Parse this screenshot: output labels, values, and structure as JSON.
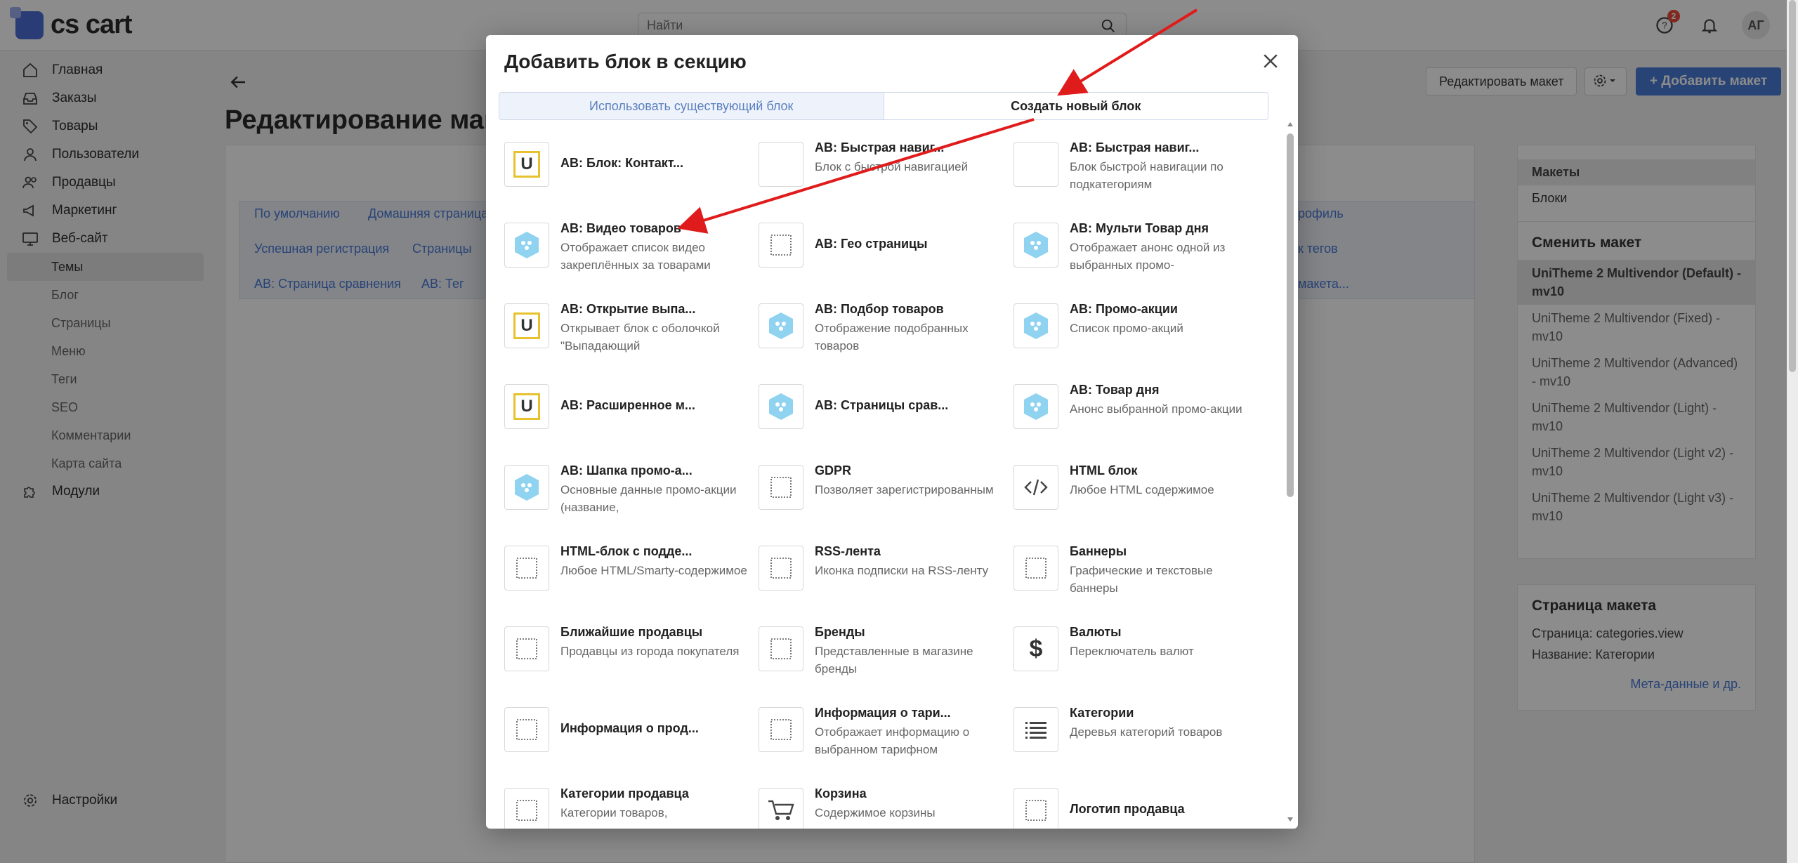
{
  "app": {
    "logo_text": "cs cart"
  },
  "search": {
    "placeholder": "Найти"
  },
  "header": {
    "notifications_count": "2",
    "avatar_initials": "АГ"
  },
  "sidebar": {
    "items": [
      {
        "label": "Главная",
        "icon": "home-icon"
      },
      {
        "label": "Заказы",
        "icon": "inbox-icon"
      },
      {
        "label": "Товары",
        "icon": "tag-icon"
      },
      {
        "label": "Пользователи",
        "icon": "user-icon"
      },
      {
        "label": "Продавцы",
        "icon": "users-icon"
      },
      {
        "label": "Маркетинг",
        "icon": "megaphone-icon"
      },
      {
        "label": "Веб-сайт",
        "icon": "monitor-icon"
      },
      {
        "label": "Модули",
        "icon": "puzzle-icon"
      },
      {
        "label": "Настройки",
        "icon": "gear-icon"
      }
    ],
    "subitems": [
      "Темы",
      "Блог",
      "Страницы",
      "Меню",
      "Теги",
      "SEO",
      "Комментарии",
      "Карта сайта"
    ]
  },
  "page": {
    "title": "Редактирование мак",
    "edit_layout_button": "Редактировать макет",
    "add_layout_button": "Добавить макет",
    "tabs": [
      "По умолчанию",
      "Домашняя страница",
      "Успешная регистрация",
      "Страницы",
      "AB: Страница сравнения",
      "AB: Тег"
    ],
    "tabs_right": [
      "рофиль",
      "к тегов",
      "макета..."
    ],
    "right_panel": {
      "layouts_label": "Макеты",
      "blocks_label": "Блоки",
      "change_layout_title": "Сменить макет",
      "layouts": [
        "UniTheme 2 Multivendor (Default) - mv10",
        "UniTheme 2 Multivendor (Fixed) - mv10",
        "UniTheme 2 Multivendor (Advanced) - mv10",
        "UniTheme 2 Multivendor (Light) - mv10",
        "UniTheme 2 Multivendor (Light v2) - mv10",
        "UniTheme 2 Multivendor (Light v3) - mv10"
      ],
      "layout_page_title": "Страница макета",
      "layout_page_info": "Страница: categories.view",
      "layout_name_info": "Название: Категории",
      "meta_link": "Мета-данные и др."
    }
  },
  "modal": {
    "title": "Добавить блок в секцию",
    "tab_existing": "Использовать существующий блок",
    "tab_new": "Создать новый блок",
    "blocks": [
      {
        "title": "AB: Блок: Контакт...",
        "desc": "",
        "icon": "u-icon"
      },
      {
        "title": "AB: Быстрая навиг...",
        "desc": "Блок с быстрой навигацией",
        "icon": "blank-icon"
      },
      {
        "title": "AB: Быстрая навиг...",
        "desc": "Блок быстрой навигации по подкатегориям",
        "icon": "blank-icon"
      },
      {
        "title": "AB: Видео товаров",
        "desc": "Отображает список видео закреплённых за товарами",
        "icon": "hex-icon"
      },
      {
        "title": "AB: Гео страницы",
        "desc": "",
        "icon": "dotted-square-icon"
      },
      {
        "title": "AB: Мульти Товар дня",
        "desc": "Отображает анонс одной из выбранных промо-",
        "icon": "hex-icon"
      },
      {
        "title": "AB: Открытие выпа...",
        "desc": "Открывает блок с оболочкой \"Выпадающий",
        "icon": "u-icon"
      },
      {
        "title": "AB: Подбор товаров",
        "desc": "Отображение подобранных товаров",
        "icon": "hex-icon"
      },
      {
        "title": "AB: Промо-акции",
        "desc": "Список промо-акций",
        "icon": "hex-icon"
      },
      {
        "title": "AB: Расширенное м...",
        "desc": "",
        "icon": "u-icon"
      },
      {
        "title": "AB: Страницы срав...",
        "desc": "",
        "icon": "hex-icon"
      },
      {
        "title": "AB: Товар дня",
        "desc": "Анонс выбранной промо-акции",
        "icon": "hex-icon"
      },
      {
        "title": "AB: Шапка промо-а...",
        "desc": "Основные данные промо-акции (название,",
        "icon": "hex-icon"
      },
      {
        "title": "GDPR",
        "desc": "Позволяет зарегистрированным",
        "icon": "dotted-square-icon"
      },
      {
        "title": "HTML блок",
        "desc": "Любое HTML содержимое",
        "icon": "code-icon"
      },
      {
        "title": "HTML-блок с подде...",
        "desc": "Любое HTML/Smarty-содержимое",
        "icon": "dotted-square-icon"
      },
      {
        "title": "RSS-лента",
        "desc": "Иконка подписки на RSS-ленту",
        "icon": "dotted-square-icon"
      },
      {
        "title": "Баннеры",
        "desc": "Графические и текстовые баннеры",
        "icon": "dotted-square-icon"
      },
      {
        "title": "Ближайшие продавцы",
        "desc": "Продавцы из города покупателя",
        "icon": "dotted-square-icon"
      },
      {
        "title": "Бренды",
        "desc": "Представленные в магазине бренды",
        "icon": "dotted-square-icon"
      },
      {
        "title": "Валюты",
        "desc": "Переключатель валют",
        "icon": "dollar-icon"
      },
      {
        "title": "Информация о прод...",
        "desc": "",
        "icon": "dotted-square-icon"
      },
      {
        "title": "Информация о тари...",
        "desc": "Отображает информацию о выбранном тарифном",
        "icon": "dotted-square-icon"
      },
      {
        "title": "Категории",
        "desc": "Деревья категорий товаров",
        "icon": "list-icon"
      },
      {
        "title": "Категории продавца",
        "desc": "Категории товаров,",
        "icon": "dotted-square-icon"
      },
      {
        "title": "Корзина",
        "desc": "Содержимое корзины",
        "icon": "cart-icon"
      },
      {
        "title": "Логотип продавца",
        "desc": "",
        "icon": "dotted-square-icon"
      }
    ]
  },
  "colors": {
    "accent": "#4a7bd8",
    "arrow": "#e01b1b",
    "hex_icon": "#8fd3f0"
  }
}
